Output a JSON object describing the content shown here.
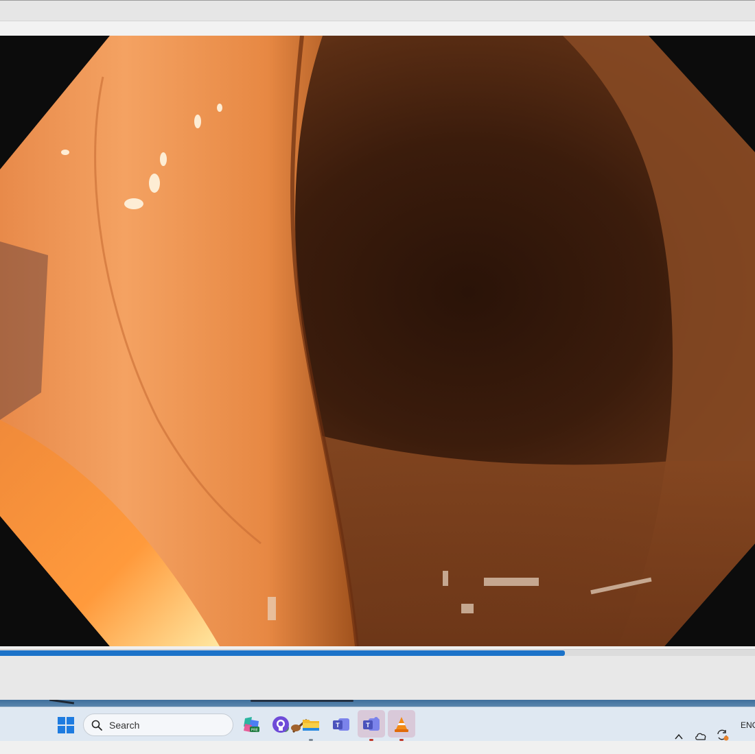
{
  "window": {
    "seek": {
      "progress": 0.748
    }
  },
  "taskbar": {
    "search_placeholder": "Search",
    "apps": [
      {
        "name": "copilot-icon"
      },
      {
        "name": "github-icon"
      },
      {
        "name": "file-explorer-icon"
      },
      {
        "name": "teams-classic-icon"
      },
      {
        "name": "teams-icon"
      },
      {
        "name": "vlc-icon"
      }
    ],
    "tray": {
      "language": "ENG"
    }
  },
  "colors": {
    "accent": "#1c73c9",
    "taskbar_bg": "#dfe8f2"
  }
}
